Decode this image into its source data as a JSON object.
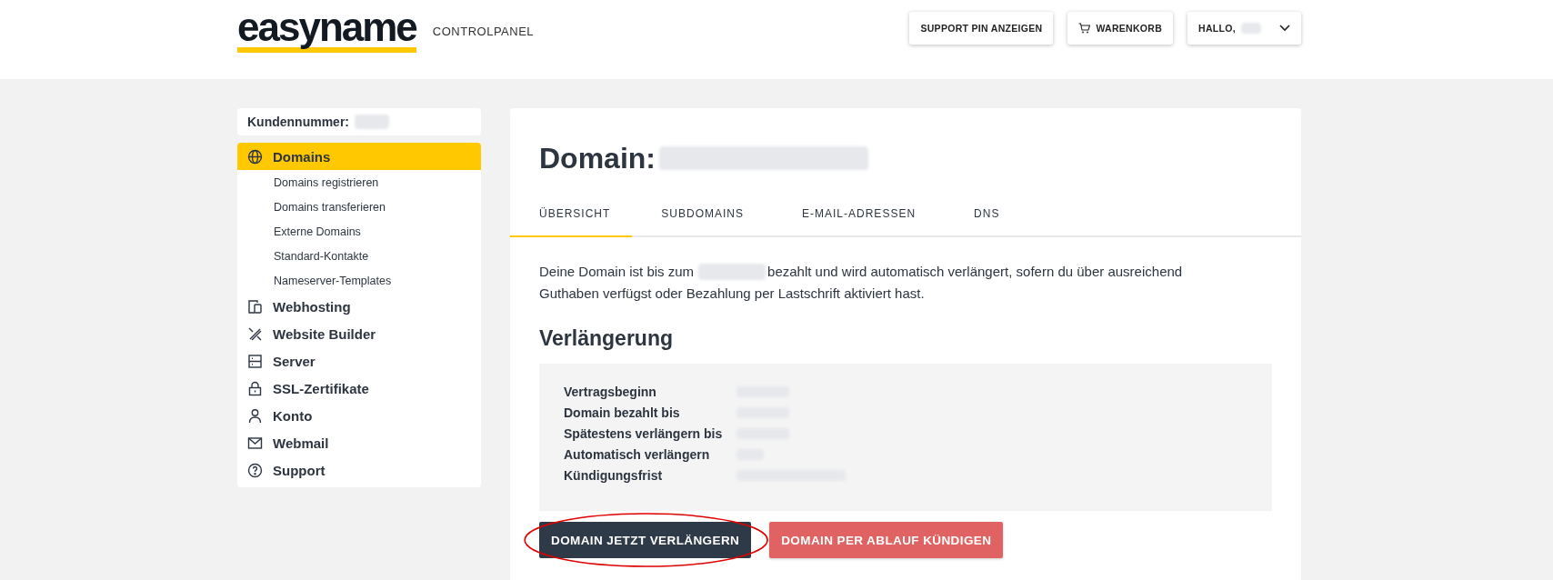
{
  "header": {
    "logo": "easyname",
    "subtitle": "CONTROLPANEL",
    "buttons": [
      {
        "label": "SUPPORT PIN ANZEIGEN",
        "kind": "plain"
      },
      {
        "label": "WARENKORB",
        "kind": "cart"
      },
      {
        "label": "HALLO,",
        "kind": "user"
      }
    ]
  },
  "sidebar": {
    "customer_label": "Kundennummer:",
    "items": [
      {
        "label": "Domains",
        "selected": true,
        "children": [
          {
            "label": "Domains registrieren"
          },
          {
            "label": "Domains transferieren"
          },
          {
            "label": "Externe Domains"
          },
          {
            "label": "Standard-Kontakte"
          },
          {
            "label": "Nameserver-Templates"
          }
        ]
      },
      {
        "label": "Webhosting",
        "selected": false
      },
      {
        "label": "Website Builder",
        "selected": false
      },
      {
        "label": "Server",
        "selected": false
      },
      {
        "label": "SSL-Zertifikate",
        "selected": false
      },
      {
        "label": "Konto",
        "selected": false
      },
      {
        "label": "Webmail",
        "selected": false
      },
      {
        "label": "Support",
        "selected": false
      }
    ]
  },
  "main": {
    "title": "Domain:",
    "tabs": [
      {
        "label": "ÜBERSICHT",
        "selected": true
      },
      {
        "label": "SUBDOMAINS",
        "selected": false
      },
      {
        "label": "E-MAIL-ADRESSEN",
        "selected": false
      },
      {
        "label": "DNS",
        "selected": false
      }
    ],
    "intro_before": "Deine Domain ist bis zum",
    "intro_after": "bezahlt und wird automatisch verlängert, sofern du über ausreichend",
    "intro_line2": "Guthaben verfügst oder Bezahlung per Lastschrift aktiviert hast.",
    "section_title": "Verlängerung",
    "details": [
      {
        "label": "Vertragsbeginn"
      },
      {
        "label": "Domain bezahlt bis"
      },
      {
        "label": "Spätestens verlängern bis"
      },
      {
        "label": "Automatisch verlängern"
      },
      {
        "label": "Kündigungsfrist"
      }
    ],
    "actions": [
      {
        "label": "DOMAIN JETZT VERLÄNGERN",
        "kind": "primary",
        "highlighted": true
      },
      {
        "label": "DOMAIN PER ABLAUF KÜNDIGEN",
        "kind": "danger",
        "highlighted": false
      }
    ]
  }
}
